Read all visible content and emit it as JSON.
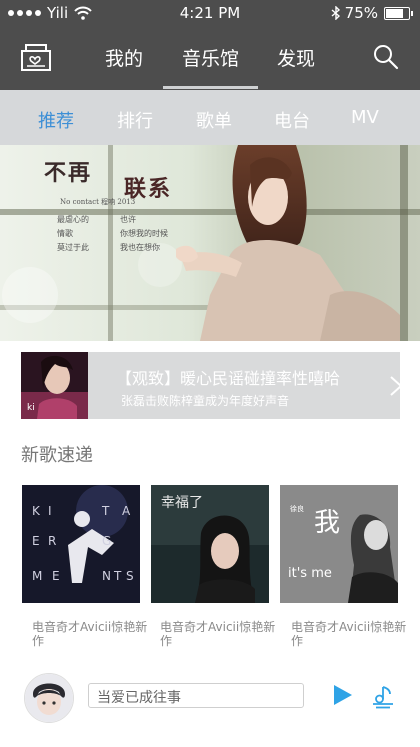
{
  "status_bar": {
    "carrier": "Yili",
    "time": "4:21 PM",
    "battery": "75%",
    "battery_level": 0.75,
    "icons": [
      "signal-dots",
      "wifi-icon",
      "bluetooth-icon",
      "battery-icon"
    ]
  },
  "nav": {
    "logo_icon": "music-box-icon",
    "tabs": [
      {
        "label": "我的"
      },
      {
        "label": "音乐馆"
      },
      {
        "label": "发现"
      }
    ],
    "active_tab": "音乐馆",
    "search_icon": "search-icon"
  },
  "sub_tabs": {
    "items": [
      {
        "label": "推荐"
      },
      {
        "label": "排行"
      },
      {
        "label": "歌单"
      },
      {
        "label": "电台"
      },
      {
        "label": "MV"
      }
    ],
    "active": "推荐",
    "active_color": "#3d8fd6"
  },
  "banner": {
    "title_left": "不再",
    "title_right": "联系",
    "subtitle": "No contact  程响 2013",
    "lyrics_left": [
      "最虐心的",
      "情歌",
      "莫过于此"
    ],
    "lyrics_right": [
      "也许",
      "你想我的时候",
      "我也在想你"
    ]
  },
  "promo": {
    "title": "【观致】暖心民谣碰撞率性嘻哈",
    "subtitle": "张磊击败陈梓童成为年度好声音",
    "chevron_icon": "chevron-right-icon"
  },
  "new_songs": {
    "title": "新歌速递",
    "albums": [
      {
        "caption": "电音奇才Avicii惊艳新作",
        "cover_text": [
          "K",
          "I",
          "T",
          "A",
          "E",
          "R",
          "G",
          "M",
          "E",
          "N",
          "T",
          "S"
        ]
      },
      {
        "caption": "电音奇才Avicii惊艳新作",
        "cover_text": [
          "幸福了"
        ]
      },
      {
        "caption": "电音奇才Avicii惊艳新作",
        "cover_text": [
          "我",
          "it's me",
          "徐良"
        ]
      }
    ]
  },
  "player": {
    "track": "当爱已成往事",
    "play_icon": "play-icon",
    "queue_icon": "music-queue-icon",
    "accent": "#2fa3e6"
  }
}
